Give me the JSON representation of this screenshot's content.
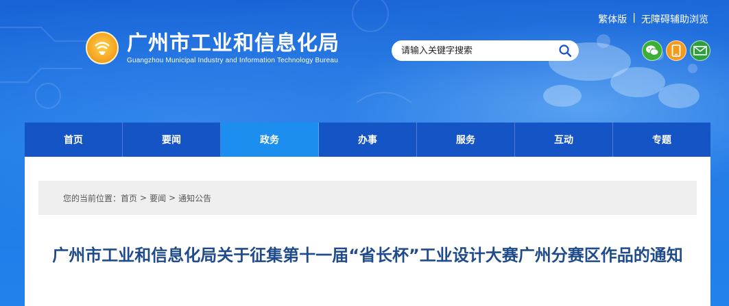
{
  "header": {
    "links": [
      {
        "label": "繁体版"
      },
      {
        "label": "|"
      },
      {
        "label": "无障碍辅助浏览"
      }
    ],
    "site_name": "广州市工业和信息化局",
    "site_name_en": "Guangzhou Municipal Industry and Information Technology Bureau",
    "search": {
      "placeholder": "请输入关键字搜索"
    },
    "social_icons": [
      "wechat-icon",
      "mobile-icon",
      "mail-icon"
    ],
    "social_colors": [
      "#3cb034",
      "#f59a1b",
      "#2e9e3f"
    ]
  },
  "nav": {
    "items": [
      {
        "label": "首页"
      },
      {
        "label": "要闻"
      },
      {
        "label": "政务"
      },
      {
        "label": "办事"
      },
      {
        "label": "服务"
      },
      {
        "label": "互动"
      },
      {
        "label": "专题"
      }
    ],
    "active_index": 2
  },
  "breadcrumb": {
    "prefix": "您的当前位置：",
    "items": [
      "首页",
      "要闻",
      "通知公告"
    ],
    "separator": ">"
  },
  "article": {
    "title": "广州市工业和信息化局关于征集第十一届“省长杯”工业设计大赛广州分赛区作品的通知"
  }
}
